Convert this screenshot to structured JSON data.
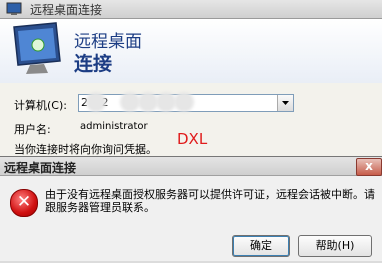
{
  "main_window": {
    "title": "远程桌面连接",
    "banner_line1": "远程桌面",
    "banner_line2": "连接"
  },
  "form": {
    "computer_label": "计算机(C):",
    "computer_value": "20 2",
    "username_label": "用户名:",
    "username_value": "administrator",
    "credentials_note": "当你连接时将向你询问凭据。"
  },
  "annotation": "DXL",
  "error_dialog": {
    "title": "远程桌面连接",
    "close_glyph": "x",
    "message": "由于没有远程桌面授权服务器可以提供许可证，远程会话被中断。请跟服务器管理员联系。",
    "ok_label": "确定",
    "help_label": "帮助(H)"
  },
  "icons": {
    "title_icon": "remote-desktop-icon",
    "banner_icon": "remote-desktop-monitor-icon",
    "error_icon": "error-icon",
    "dropdown_icon": "chevron-down-icon"
  }
}
